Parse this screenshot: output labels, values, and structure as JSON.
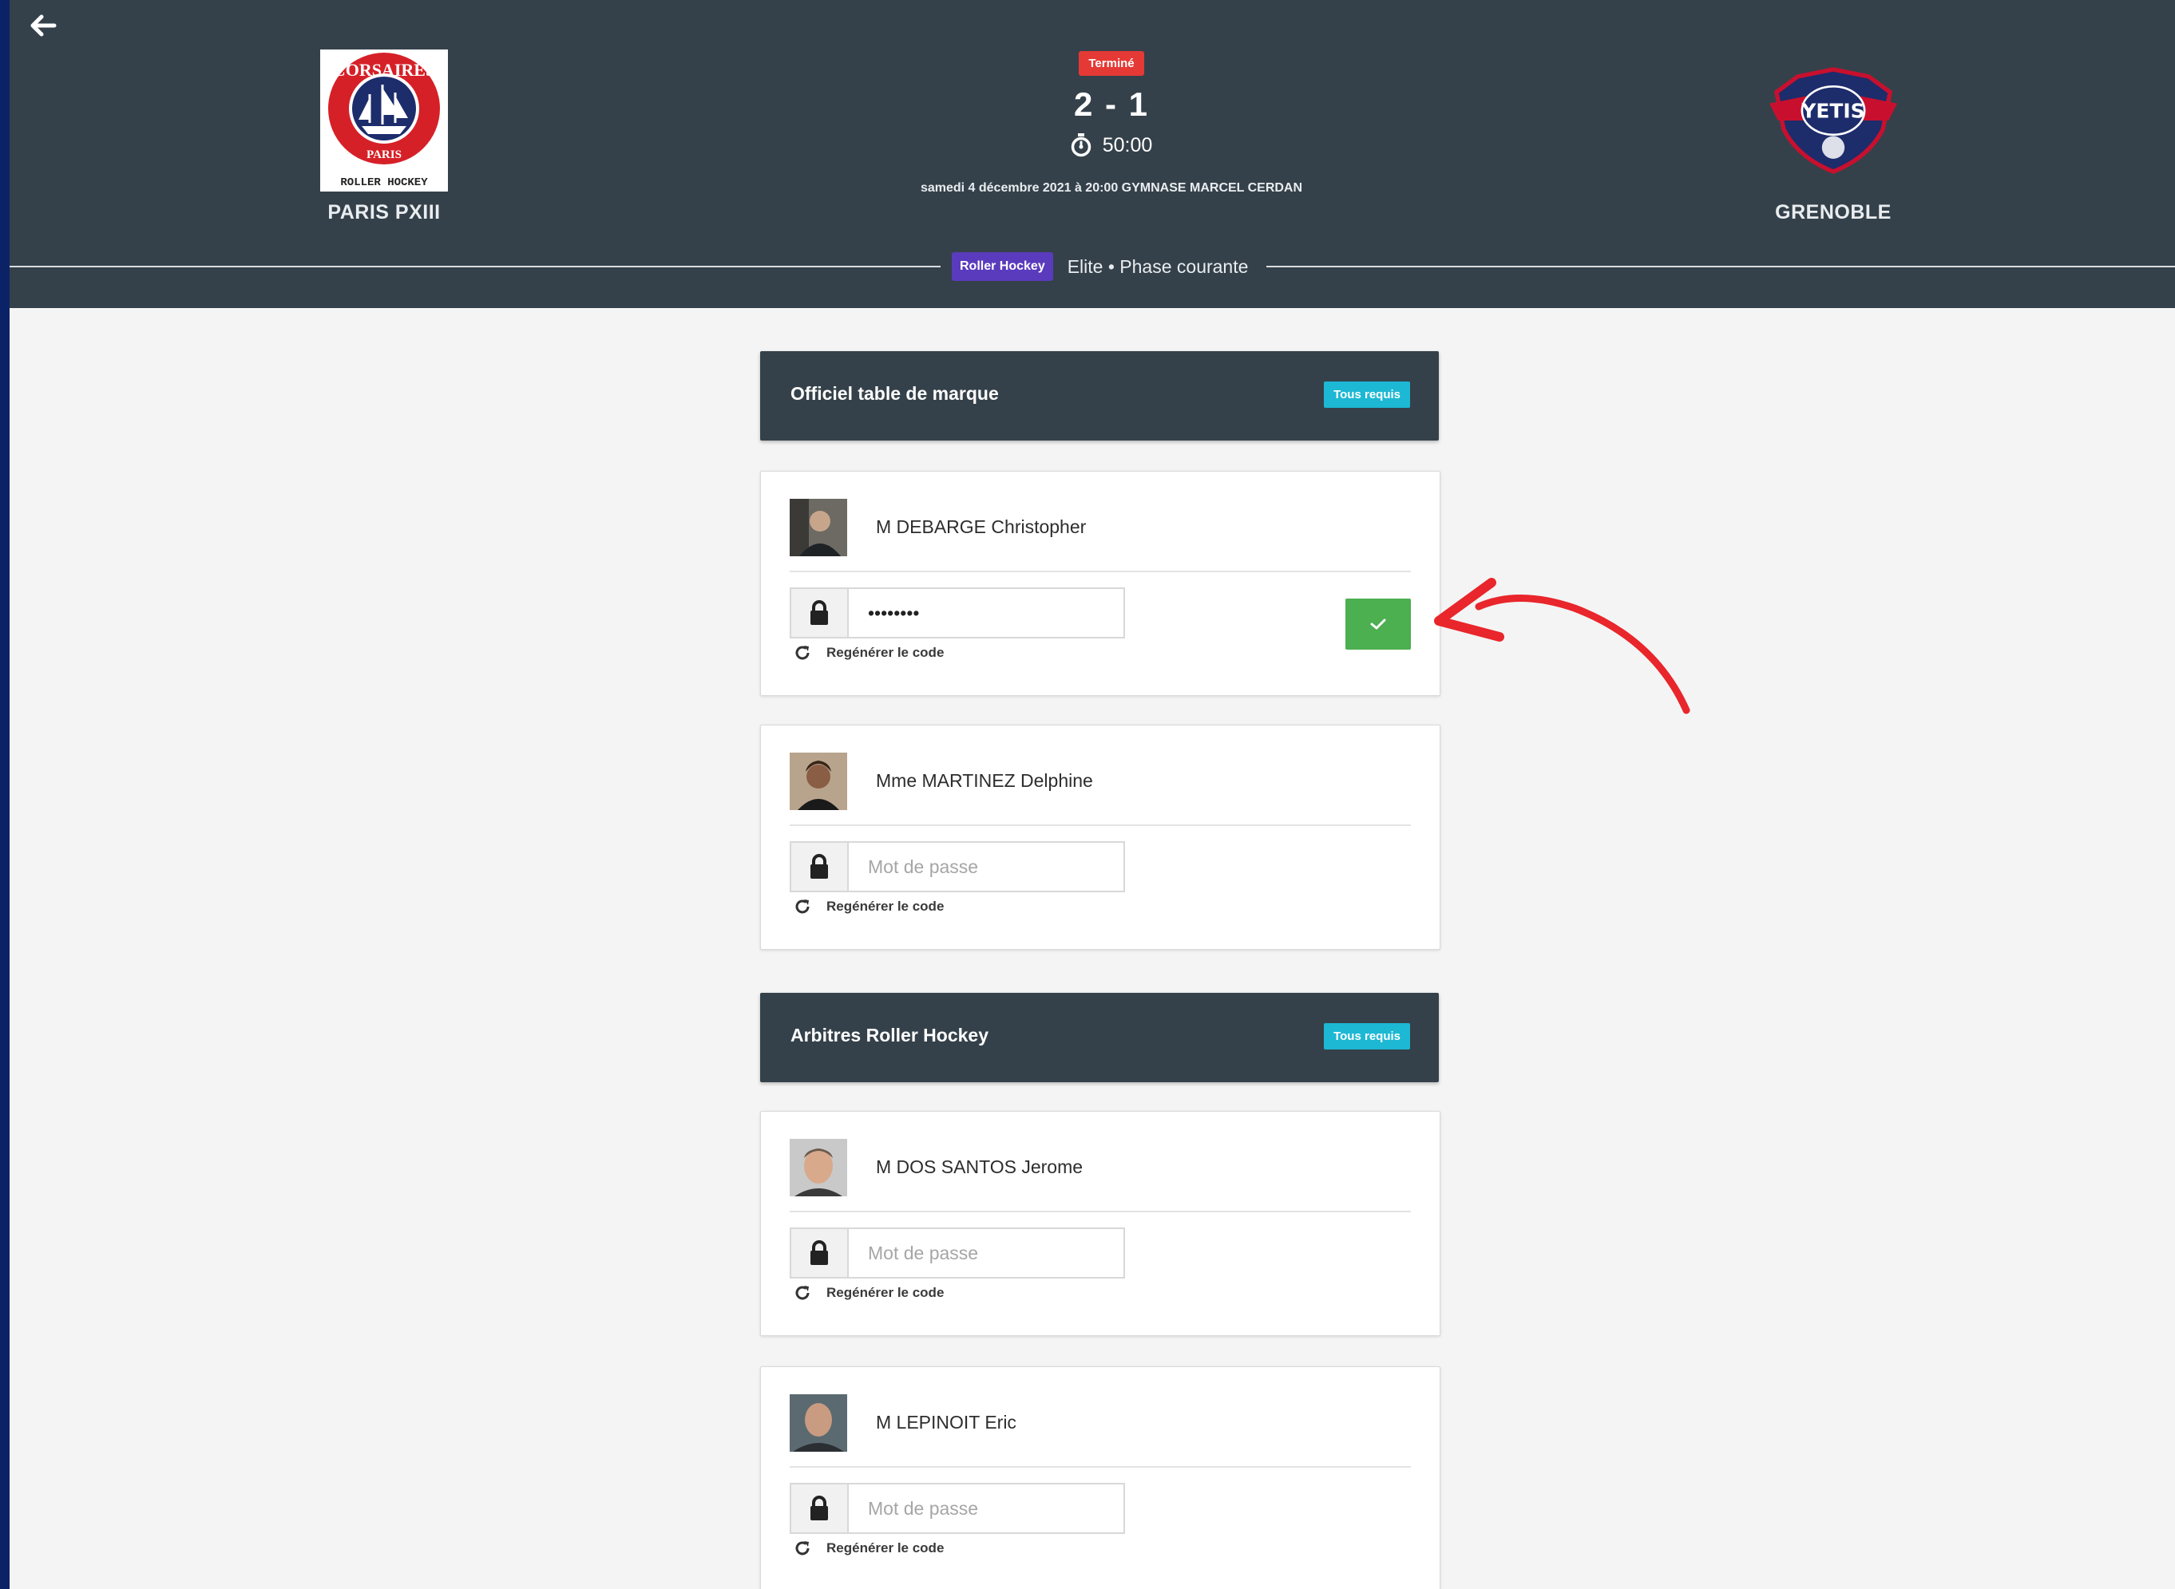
{
  "header": {
    "home_team": {
      "name": "PARIS PXIII"
    },
    "away_team": {
      "name": "GRENOBLE"
    },
    "status": "Terminé",
    "score": "2 - 1",
    "time": "50:00",
    "datetime_venue": "samedi 4 décembre 2021 à 20:00 GYMNASE MARCEL CERDAN",
    "sport": "Roller Hockey",
    "competition": "Elite • Phase courante"
  },
  "logos": {
    "home_text_top": "CORSAIRES",
    "home_text_mid": "PARIS",
    "home_text_bottom": "ROLLER HOCKEY",
    "away_text": "YETIS"
  },
  "sections": [
    {
      "title": "Officiel table de marque",
      "badge": "Tous requis",
      "people": [
        {
          "name": "M DEBARGE Christopher",
          "password_value": "••••••••",
          "placeholder": "Mot de passe",
          "regen_label": "Regénérer le code",
          "confirmed": true
        },
        {
          "name": "Mme MARTINEZ Delphine",
          "password_value": "",
          "placeholder": "Mot de passe",
          "regen_label": "Regénérer le code",
          "confirmed": false
        }
      ]
    },
    {
      "title": "Arbitres Roller Hockey",
      "badge": "Tous requis",
      "people": [
        {
          "name": "M DOS SANTOS Jerome",
          "password_value": "",
          "placeholder": "Mot de passe",
          "regen_label": "Regénérer le code",
          "confirmed": false
        },
        {
          "name": "M LEPINOIT Eric",
          "password_value": "",
          "placeholder": "Mot de passe",
          "regen_label": "Regénérer le code",
          "confirmed": false
        }
      ]
    }
  ],
  "icons": {
    "back": "arrow-left-icon",
    "timer": "stopwatch-icon",
    "lock": "lock-icon",
    "regen": "refresh-icon",
    "confirm": "check-icon",
    "annotation": "red-curved-arrow"
  },
  "colors": {
    "header_bg": "#35414a",
    "status_red": "#e53935",
    "sport_purple": "#5a3bbd",
    "required_cyan": "#1cb8d4",
    "confirm_green": "#4caf50",
    "annotation_red": "#e8262b"
  }
}
